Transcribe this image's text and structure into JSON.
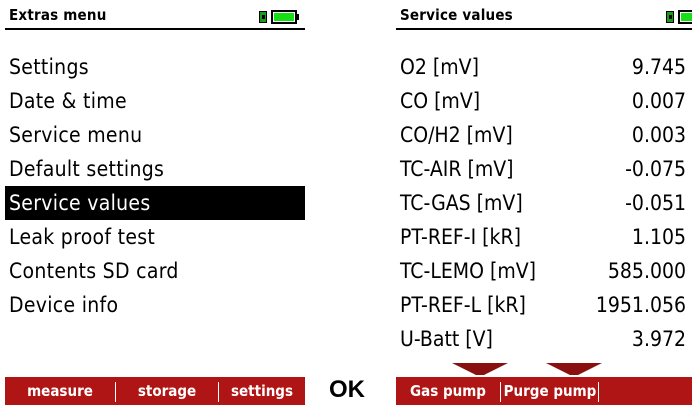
{
  "left": {
    "title": "Extras menu",
    "items": [
      {
        "label": "Settings",
        "selected": false
      },
      {
        "label": "Date & time",
        "selected": false
      },
      {
        "label": "Service menu",
        "selected": false
      },
      {
        "label": "Default settings",
        "selected": false
      },
      {
        "label": "Service values",
        "selected": true
      },
      {
        "label": "Leak proof test",
        "selected": false
      },
      {
        "label": "Contents SD card",
        "selected": false
      },
      {
        "label": "Device info",
        "selected": false
      }
    ],
    "softkeys": [
      "measure",
      "storage",
      "settings"
    ]
  },
  "ok_key": "OK",
  "right": {
    "title": "Service values",
    "values": [
      {
        "label": "O2 [mV]",
        "value": "9.745"
      },
      {
        "label": "CO [mV]",
        "value": "0.007"
      },
      {
        "label": "CO/H2 [mV]",
        "value": "0.003"
      },
      {
        "label": "TC-AIR [mV]",
        "value": "-0.075"
      },
      {
        "label": "TC-GAS [mV]",
        "value": "-0.051"
      },
      {
        "label": "PT-REF-I [kR]",
        "value": "1.105"
      },
      {
        "label": "TC-LEMO [mV]",
        "value": "585.000"
      },
      {
        "label": "PT-REF-L [kR]",
        "value": "1951.056"
      },
      {
        "label": "U-Batt [V]",
        "value": "3.972"
      }
    ],
    "softkeys": [
      "Gas pump",
      "Purge pump"
    ]
  },
  "colors": {
    "softkey_bar": "#b01515",
    "battery_fill": "#14e014",
    "selected_bg": "#000000"
  },
  "icons": {
    "status": "battery-plug-icon",
    "scroll": "scroll-down-arrow-icon"
  }
}
